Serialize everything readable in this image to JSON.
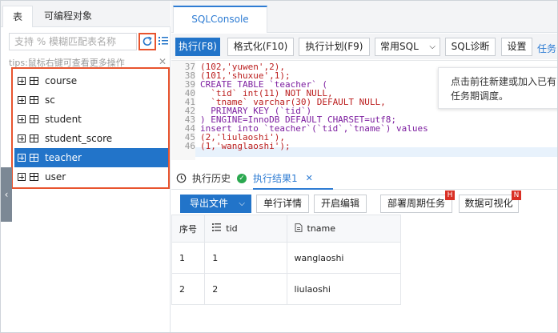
{
  "left": {
    "tabs": [
      "表",
      "可编程对象"
    ],
    "search_placeholder": "支持 % 模糊匹配表名称",
    "tips": "tips:鼠标右键可查看更多操作",
    "tables": [
      "course",
      "sc",
      "student",
      "student_score",
      "teacher",
      "user"
    ],
    "selected_table": "teacher"
  },
  "editor_tab": "SQLConsole",
  "toolbar": {
    "execute": "执行(F8)",
    "format": "格式化(F10)",
    "plan": "执行计划(F9)",
    "common_sql": "常用SQL",
    "diagnose": "SQL诊断",
    "settings": "设置",
    "task": "任务"
  },
  "editor": {
    "line_numbers": [
      "37",
      "38",
      "39",
      "40",
      "41",
      "42",
      "43",
      "44",
      "45",
      "46"
    ],
    "lines": [
      "(102,'yuwen',2),",
      "(101,'shuxue',1);",
      "CREATE TABLE `teacher` (",
      "  `tid` int(11) NOT NULL,",
      "  `tname` varchar(30) DEFAULT NULL,",
      "  PRIMARY KEY (`tid`)",
      ") ENGINE=InnoDB DEFAULT CHARSET=utf8;",
      "insert into `teacher`(`tid`,`tname`) values",
      "(2,'liulaoshi'),",
      "(1,'wanglaoshi');"
    ],
    "tooltip": "点击前往新建或加入已有任务期调度。"
  },
  "result_tabs": {
    "history": "执行历史",
    "result": "执行结果1"
  },
  "result_toolbar": {
    "export": "导出文件",
    "row_detail": "单行详情",
    "edit": "开启编辑",
    "deploy": "部署周期任务",
    "visualize": "数据可视化",
    "badge": "H",
    "badge2": "N"
  },
  "result_table": {
    "columns": [
      "序号",
      "tid",
      "tname"
    ],
    "rows": [
      [
        "1",
        "1",
        "wanglaoshi"
      ],
      [
        "2",
        "2",
        "liulaoshi"
      ]
    ]
  },
  "colors": {
    "accent": "#2274c9",
    "highlight_border": "#e8542e",
    "badge": "#d93025"
  }
}
